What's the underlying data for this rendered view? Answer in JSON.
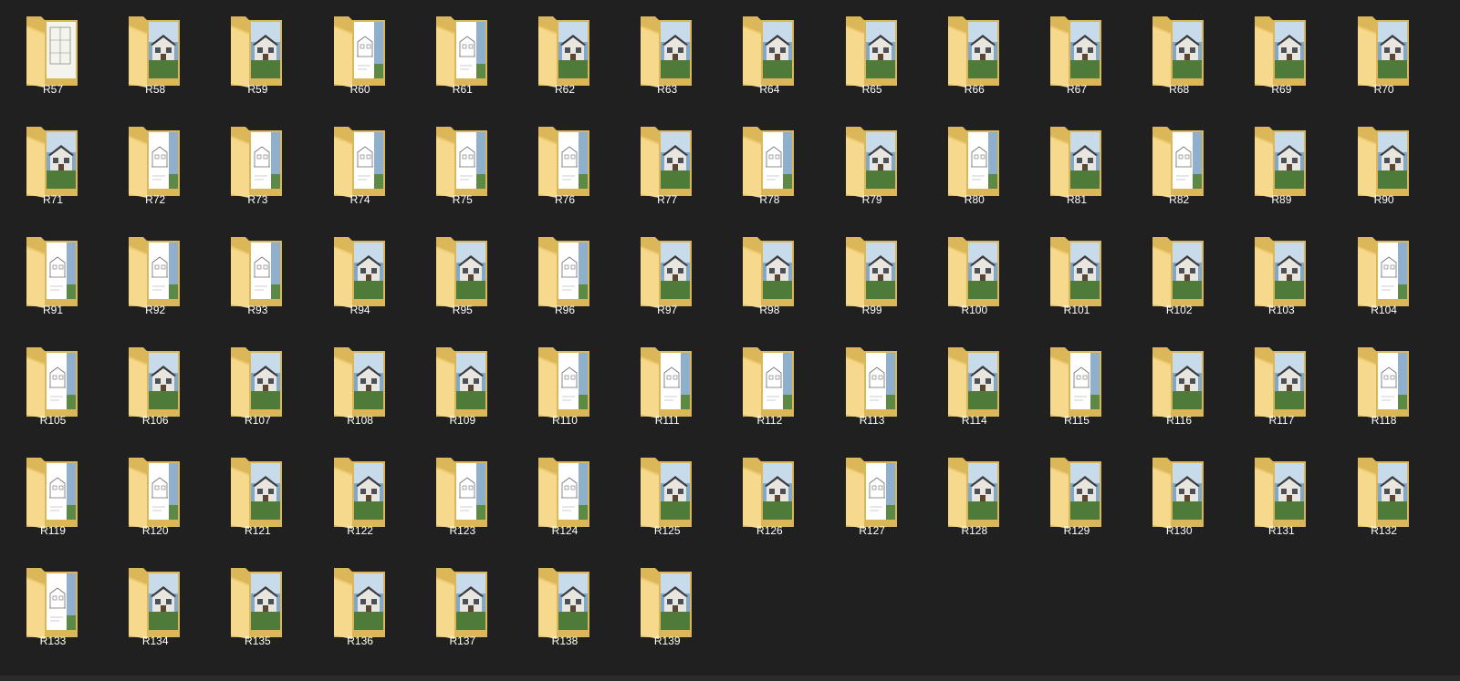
{
  "view": {
    "background": "#202020",
    "label_color": "#ffffff",
    "folder_colors": {
      "back": "#dcb75a",
      "front": "#f6d98c",
      "front_edge": "#eecb72",
      "paper": "#ffffff"
    }
  },
  "folders": [
    "R57",
    "R58",
    "R59",
    "R60",
    "R61",
    "R62",
    "R63",
    "R64",
    "R65",
    "R66",
    "R67",
    "R68",
    "R69",
    "R70",
    "R71",
    "R72",
    "R73",
    "R74",
    "R75",
    "R76",
    "R77",
    "R78",
    "R79",
    "R80",
    "R81",
    "R82",
    "R89",
    "R90",
    "R91",
    "R92",
    "R93",
    "R94",
    "R95",
    "R96",
    "R97",
    "R98",
    "R99",
    "R100",
    "R101",
    "R102",
    "R103",
    "R104",
    "R105",
    "R106",
    "R107",
    "R108",
    "R109",
    "R110",
    "R111",
    "R112",
    "R113",
    "R114",
    "R115",
    "R116",
    "R117",
    "R118",
    "R119",
    "R120",
    "R121",
    "R122",
    "R123",
    "R124",
    "R125",
    "R126",
    "R127",
    "R128",
    "R129",
    "R130",
    "R131",
    "R132",
    "R133",
    "R134",
    "R135",
    "R136",
    "R137",
    "R138",
    "R139"
  ],
  "thumbnail_types": [
    "plan",
    "photo",
    "photo",
    "drawing",
    "drawing",
    "photo",
    "photo",
    "photo",
    "photo",
    "photo",
    "photo",
    "photo",
    "photo",
    "photo",
    "photo",
    "drawing",
    "drawing",
    "drawing",
    "drawing",
    "drawing",
    "photo",
    "drawing",
    "photo",
    "drawing",
    "photo",
    "drawing",
    "photo",
    "photo",
    "drawing",
    "drawing",
    "drawing",
    "photo",
    "photo",
    "drawing",
    "photo",
    "photo",
    "photo",
    "photo",
    "photo",
    "photo",
    "photo",
    "drawing",
    "drawing",
    "photo",
    "photo",
    "photo",
    "photo",
    "drawing",
    "drawing",
    "drawing",
    "drawing",
    "photo",
    "drawing",
    "photo",
    "photo",
    "drawing",
    "drawing",
    "drawing",
    "photo",
    "photo",
    "drawing",
    "drawing",
    "photo",
    "photo",
    "drawing",
    "photo",
    "photo",
    "photo",
    "photo",
    "photo",
    "drawing",
    "photo",
    "photo",
    "photo",
    "photo",
    "photo",
    "photo"
  ]
}
